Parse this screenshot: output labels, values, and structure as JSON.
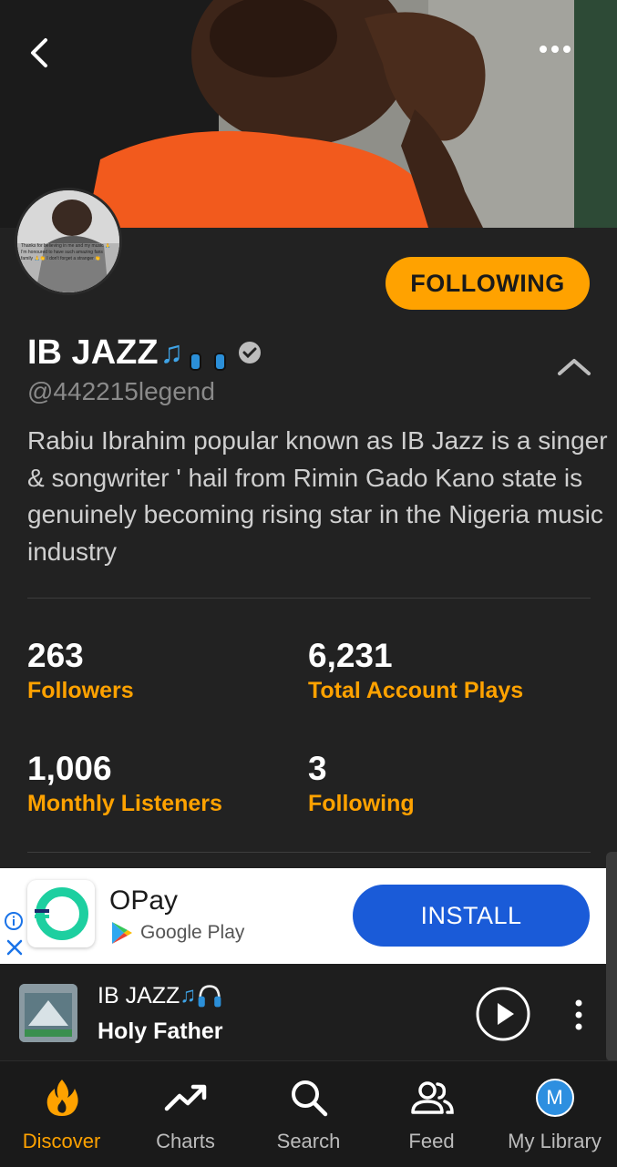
{
  "header": {
    "back_icon": "chevron-left-icon",
    "more_icon": "more-horizontal-icon"
  },
  "avatar_caption": "Thanks for believing in me and my music 🙏 I'm honoured to have such amazing fans family 🙏👏 I don't forget a stranger 👏",
  "profile": {
    "follow_label": "FOLLOWING",
    "name": "IB JAZZ",
    "name_emoji": "🎶🎧",
    "handle": "@442215legend",
    "bio": "Rabiu Ibrahim popular known as IB Jazz is a singer & songwriter ' hail from Rimin Gado Kano state is genuinely becoming rising star in the Nigeria music industry",
    "verified_icon": "verified-check-icon",
    "collapse_icon": "chevron-up-icon"
  },
  "stats": [
    {
      "value": "263",
      "label": "Followers"
    },
    {
      "value": "6,231",
      "label": "Total Account Plays"
    },
    {
      "value": "1,006",
      "label": "Monthly Listeners"
    },
    {
      "value": "3",
      "label": "Following"
    }
  ],
  "ad": {
    "app_name": "OPay",
    "store": "Google Play",
    "install_label": "INSTALL"
  },
  "player": {
    "artist": "IB JAZZ",
    "artist_emoji": "🎶🎧",
    "title": "Holy Father"
  },
  "nav": [
    {
      "label": "Discover",
      "icon": "flame-icon",
      "active": true
    },
    {
      "label": "Charts",
      "icon": "trending-up-icon",
      "active": false
    },
    {
      "label": "Search",
      "icon": "search-icon",
      "active": false
    },
    {
      "label": "Feed",
      "icon": "users-icon",
      "active": false
    },
    {
      "label": "My Library",
      "icon": "avatar-icon",
      "active": false,
      "avatar_letter": "M"
    }
  ],
  "colors": {
    "accent": "#ffa200",
    "background": "#222222",
    "install": "#1a5bd8",
    "verified": "#bdbdbd"
  }
}
